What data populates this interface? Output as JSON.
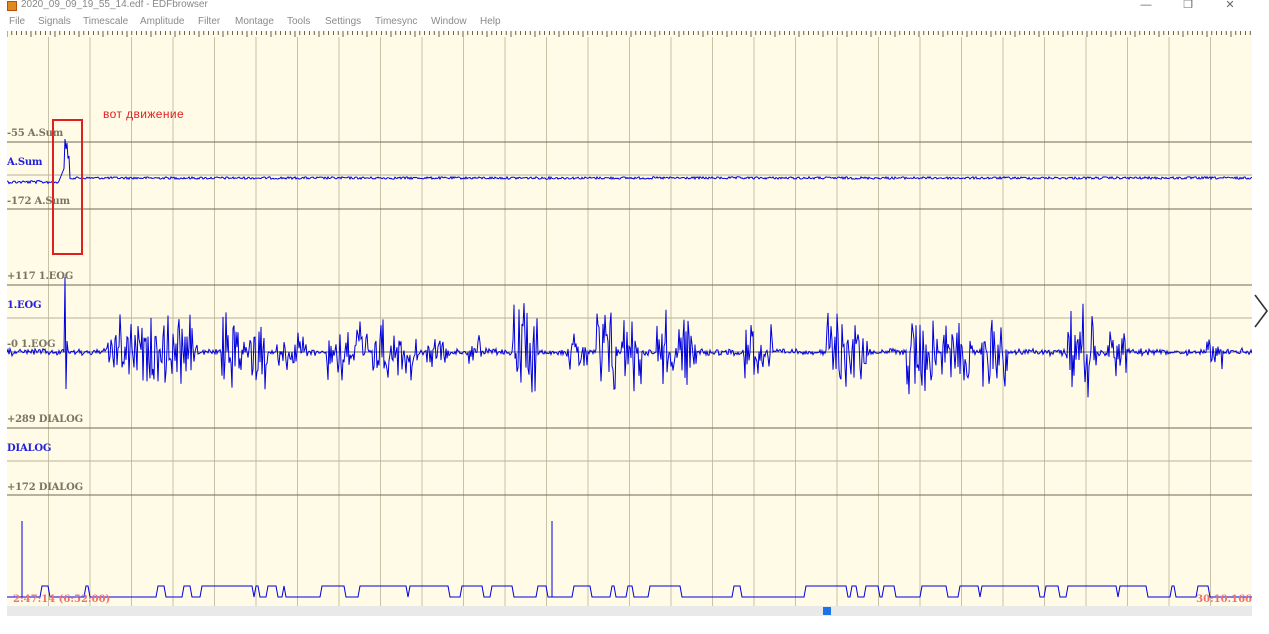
{
  "window": {
    "title": "2020_09_09_19_55_14.edf - EDFbrowser",
    "controls": {
      "minimize": "—",
      "restore": "❐",
      "close": "✕"
    }
  },
  "menu": [
    "File",
    "Signals",
    "Timescale",
    "Amplitude",
    "Filter",
    "Montage",
    "Tools",
    "Settings",
    "Timesync",
    "Window",
    "Help"
  ],
  "signals": [
    {
      "name": "A.Sum",
      "range_top": "-55 A.Sum",
      "range_bottom": "-172 A.Sum"
    },
    {
      "name": "1.EOG",
      "range_top": "+117 1.EOG",
      "range_bottom": "-0 1.EOG"
    },
    {
      "name": "DIALOG",
      "range_top": "+289 DIALOG",
      "range_bottom": "+172 DIALOG"
    }
  ],
  "annotation": {
    "text": "вот движение"
  },
  "time": {
    "start": "2:47:14 (6:52:00)",
    "end": "30:10.166"
  },
  "colors": {
    "background": "#fffbe6",
    "trace": "#0000dd",
    "label": "#2020dd",
    "annotation": "#e02020",
    "time": "#f07070",
    "scroll_thumb": "#1a73e8"
  }
}
